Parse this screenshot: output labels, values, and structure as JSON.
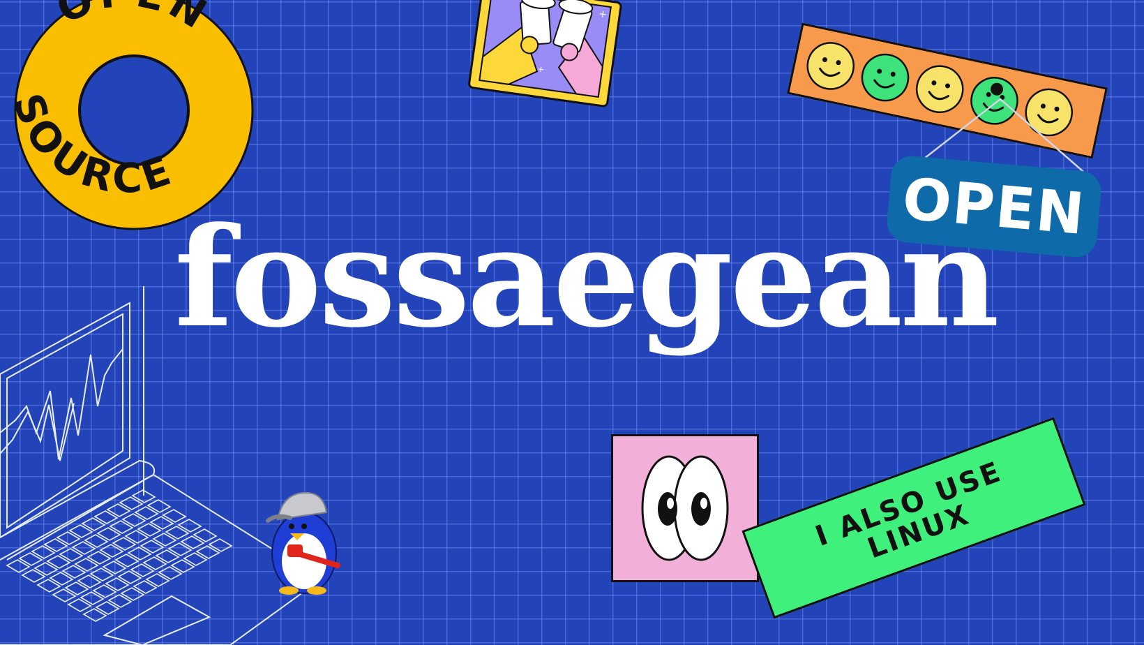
{
  "brand": {
    "wordmark": "fossaegean"
  },
  "stickers": {
    "open_source_ring": {
      "line1": "OPEN",
      "line2": "SOURCE"
    },
    "open_sign": "OPEN",
    "linux_tag": {
      "line1": "I ALSO USE",
      "line2": "LINUX"
    }
  },
  "colors": {
    "background": "#2344b8",
    "grid": "#7896ff",
    "ring": "#f9be00",
    "smiley_strip": "#f79a4c",
    "smiley_yellow": "#f7e36a",
    "smiley_green": "#3ee27a",
    "open_sign": "#0e6aa8",
    "linux_tag": "#3ff07c",
    "eyes_tile": "#f2b0d9",
    "cheers_frame": "#fcd83a",
    "cheers_bg": "#9a8cf7"
  },
  "icons": [
    "open-source-ring-sticker",
    "cheers-mugs-sticker",
    "smiley-strip-sticker",
    "open-sign-sticker",
    "cartoon-eyes-sticker",
    "laptop-wireframe",
    "tux-penguin-plumber"
  ]
}
